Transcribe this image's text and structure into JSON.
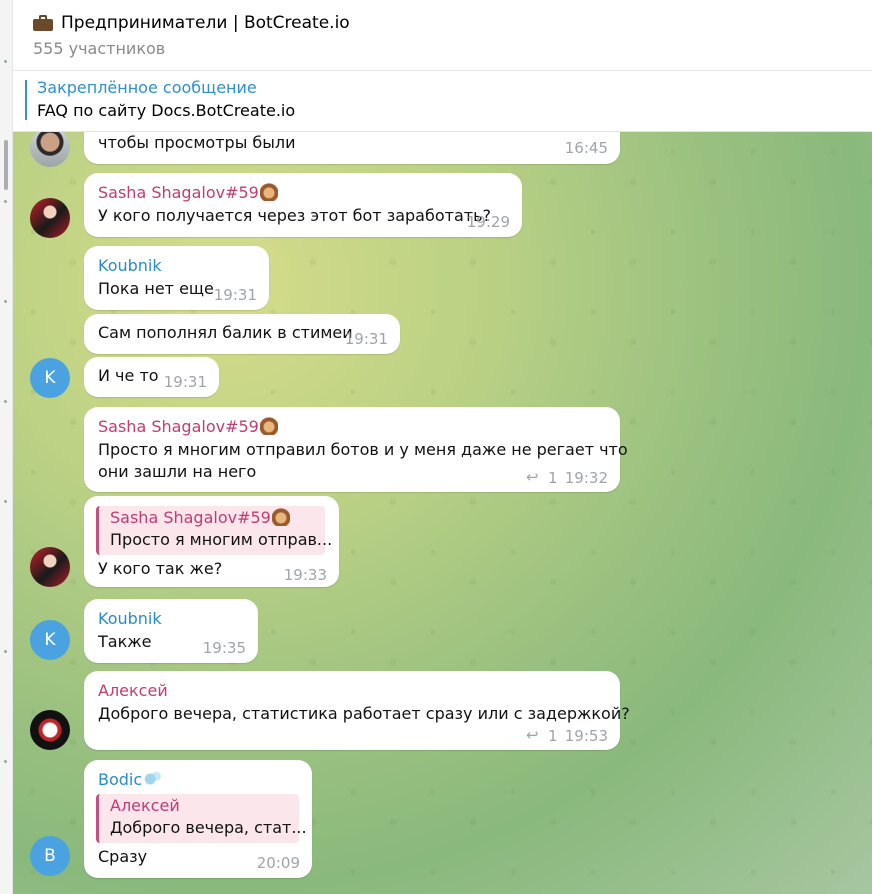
{
  "header": {
    "title": "Предприниматели | BotCreate.io",
    "members": "555 участников"
  },
  "pinned": {
    "title": "Закреплённое сообщение",
    "text": "FAQ по сайту  Docs.BotCreate.io"
  },
  "messages": [
    {
      "sender": "",
      "text": "чтобы просмотры были",
      "time": "16:45"
    },
    {
      "sender": "Sasha Shagalov#59",
      "text": "У кого получается через этот бот заработать?",
      "time": "19:29"
    },
    {
      "sender": "Koubnik",
      "text": "Пока нет еще",
      "time": "19:31"
    },
    {
      "sender": "",
      "text": "Сам пополнял балик в стимеи",
      "time": "19:31"
    },
    {
      "sender": "",
      "text": "И че то",
      "time": "19:31",
      "avatar_letter": "K"
    },
    {
      "sender": "Sasha Shagalov#59",
      "text_line1": "Просто я многим отправил ботов и у меня даже не регает что",
      "text_line2": "они зашли на него",
      "replies": "1",
      "time": "19:32"
    },
    {
      "sender": "",
      "quote_name": "Sasha Shagalov#59",
      "quote_text": "Просто я многим отправ...",
      "text": "У кого так же?",
      "time": "19:33"
    },
    {
      "sender": "Koubnik",
      "text": "Также",
      "time": "19:35",
      "avatar_letter": "K"
    },
    {
      "sender": "Алексей",
      "text": "Доброго вечера, статистика работает сразу или с задержкой?",
      "replies": "1",
      "time": "19:53"
    },
    {
      "sender": "Bodic",
      "quote_name": "Алексей",
      "quote_text": "Доброго вечера, стат...",
      "text": "Сразу",
      "time": "20:09",
      "avatar_letter": "B"
    }
  ],
  "colors": {
    "sender_pink": "#c23b72",
    "sender_blue": "#2a8cc7",
    "pinned_title": "#2f8fd0",
    "avatar_blue": "#4aa3e0"
  }
}
